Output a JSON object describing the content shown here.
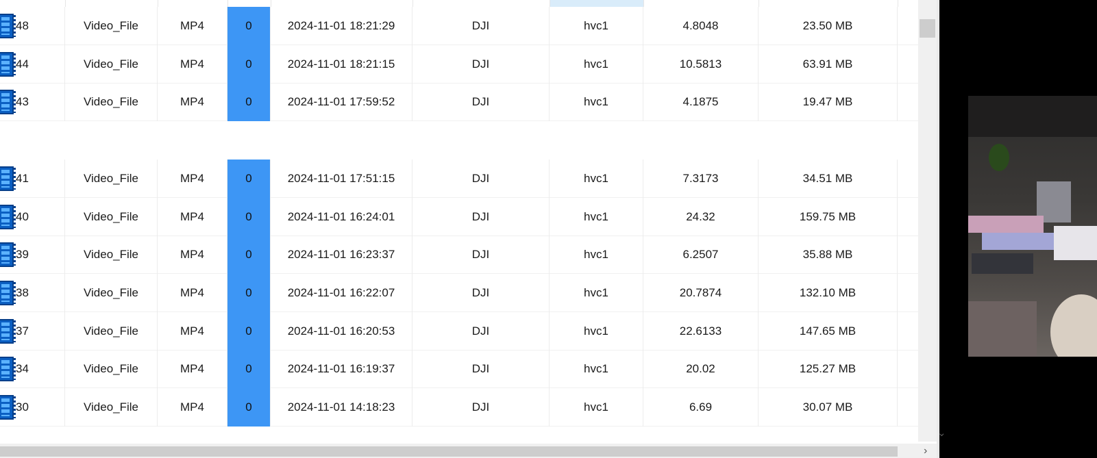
{
  "table": {
    "rows": [
      {
        "index": "48",
        "type": "Video_File",
        "format": "MP4",
        "count": "0",
        "datetime": "2024-11-01 18:21:29",
        "make": "DJI",
        "codec": "hvc1",
        "duration": "4.8048",
        "size": "23.50 MB"
      },
      {
        "index": "44",
        "type": "Video_File",
        "format": "MP4",
        "count": "0",
        "datetime": "2024-11-01 18:21:15",
        "make": "DJI",
        "codec": "hvc1",
        "duration": "10.5813",
        "size": "63.91 MB"
      },
      {
        "index": "43",
        "type": "Video_File",
        "format": "MP4",
        "count": "0",
        "datetime": "2024-11-01 17:59:52",
        "make": "DJI",
        "codec": "hvc1",
        "duration": "4.1875",
        "size": "19.47 MB"
      },
      {
        "index": "41",
        "type": "Video_File",
        "format": "MP4",
        "count": "0",
        "datetime": "2024-11-01 17:51:15",
        "make": "DJI",
        "codec": "hvc1",
        "duration": "7.3173",
        "size": "34.51 MB"
      },
      {
        "index": "40",
        "type": "Video_File",
        "format": "MP4",
        "count": "0",
        "datetime": "2024-11-01 16:24:01",
        "make": "DJI",
        "codec": "hvc1",
        "duration": "24.32",
        "size": "159.75 MB"
      },
      {
        "index": "39",
        "type": "Video_File",
        "format": "MP4",
        "count": "0",
        "datetime": "2024-11-01 16:23:37",
        "make": "DJI",
        "codec": "hvc1",
        "duration": "6.2507",
        "size": "35.88 MB"
      },
      {
        "index": "38",
        "type": "Video_File",
        "format": "MP4",
        "count": "0",
        "datetime": "2024-11-01 16:22:07",
        "make": "DJI",
        "codec": "hvc1",
        "duration": "20.7874",
        "size": "132.10 MB"
      },
      {
        "index": "37",
        "type": "Video_File",
        "format": "MP4",
        "count": "0",
        "datetime": "2024-11-01 16:20:53",
        "make": "DJI",
        "codec": "hvc1",
        "duration": "22.6133",
        "size": "147.65 MB"
      },
      {
        "index": "34",
        "type": "Video_File",
        "format": "MP4",
        "count": "0",
        "datetime": "2024-11-01 16:19:37",
        "make": "DJI",
        "codec": "hvc1",
        "duration": "20.02",
        "size": "125.27 MB"
      },
      {
        "index": "30",
        "type": "Video_File",
        "format": "MP4",
        "count": "0",
        "datetime": "2024-11-01 14:18:23",
        "make": "DJI",
        "codec": "hvc1",
        "duration": "6.69",
        "size": "30.07 MB"
      }
    ],
    "row_icon": "video-file-icon",
    "count_highlight_color": "#3d96f5"
  },
  "scrollbars": {
    "down_glyph": "⌄",
    "right_glyph": "›"
  }
}
